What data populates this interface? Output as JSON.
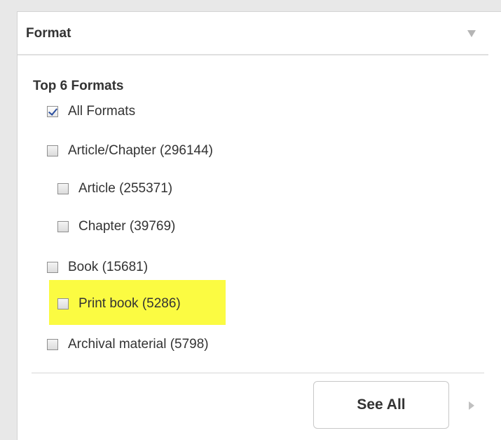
{
  "header": {
    "title": "Format",
    "collapse_icon": "triangle-down-icon"
  },
  "section": {
    "title": "Top 6 Formats"
  },
  "options": [
    {
      "label": "All Formats",
      "checked": true
    },
    {
      "label": "Article/Chapter (296144)",
      "checked": false
    },
    {
      "label": "Article (255371)",
      "checked": false
    },
    {
      "label": "Chapter (39769)",
      "checked": false
    },
    {
      "label": "Book (15681)",
      "checked": false
    },
    {
      "label": "Print book (5286)",
      "checked": false,
      "highlighted": true,
      "highlight_color": "#fbfb42"
    },
    {
      "label": "Archival material (5798)",
      "checked": false
    }
  ],
  "footer": {
    "see_all_label": "See All",
    "next_icon": "triangle-right-icon"
  }
}
